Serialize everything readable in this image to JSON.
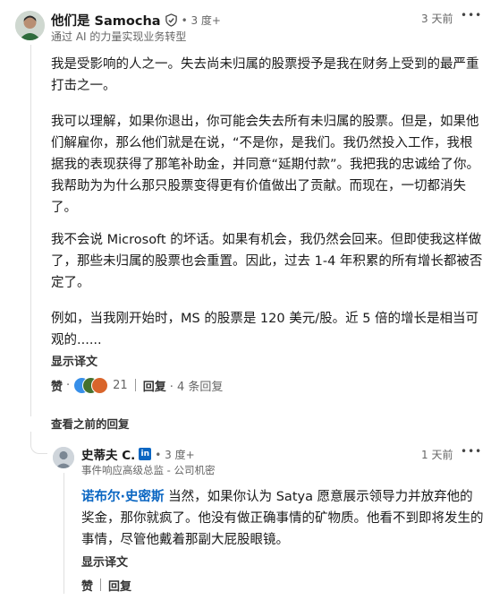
{
  "comment": {
    "author_name": "他们是 Samocha",
    "degree": "• 3 度+",
    "headline": "通过 AI 的力量实现业务转型",
    "time": "3 天前",
    "paragraphs": [
      "我是受影响的人之一。失去尚未归属的股票授予是我在财务上受到的最严重打击之一。",
      "我可以理解，如果你退出，你可能会失去所有未归属的股票。但是，如果他们解雇你，那么他们就是在说，“不是你，是我们。我仍然投入工作，我根据我的表现获得了那笔补助金，并同意“延期付款”。我把我的忠诚给了你。我帮助为为什么那只股票变得更有价值做出了贡献。而现在，一切都消失了。",
      "我不会说 Microsoft 的坏话。如果有机会，我仍然会回来。但即使我这样做了，那些未归属的股票也会重置。因此，过去 1-4 年积累的所有增长都被否定了。",
      "例如，当我刚开始时，MS 的股票是 120 美元/股。近 5 倍的增长是相当可观的......"
    ],
    "translate_label": "显示译文",
    "like_label": "赞",
    "reaction_count": "21",
    "reply_label": "回复",
    "reply_count": "· 4 条回复",
    "view_previous": "查看之前的回复"
  },
  "reply": {
    "author_name": "史蒂夫 C.",
    "in_badge": "in",
    "degree": "• 3 度+",
    "headline": "事件响应高级总监 - 公司机密",
    "time": "1 天前",
    "mention": "诺布尔·史密斯",
    "text": " 当然，如果你认为 Satya 愿意展示领导力并放弃他的奖金，那你就疯了。他没有做正确事情的矿物质。他看不到即将发生的事情，尽管他戴着那副大屁股眼镜。",
    "translate_label": "显示译文",
    "like_label": "赞",
    "reply_label": "回复"
  },
  "more_icon": "•••",
  "icons": {
    "verified": "shield-check-icon",
    "more": "more-horizontal-icon"
  }
}
